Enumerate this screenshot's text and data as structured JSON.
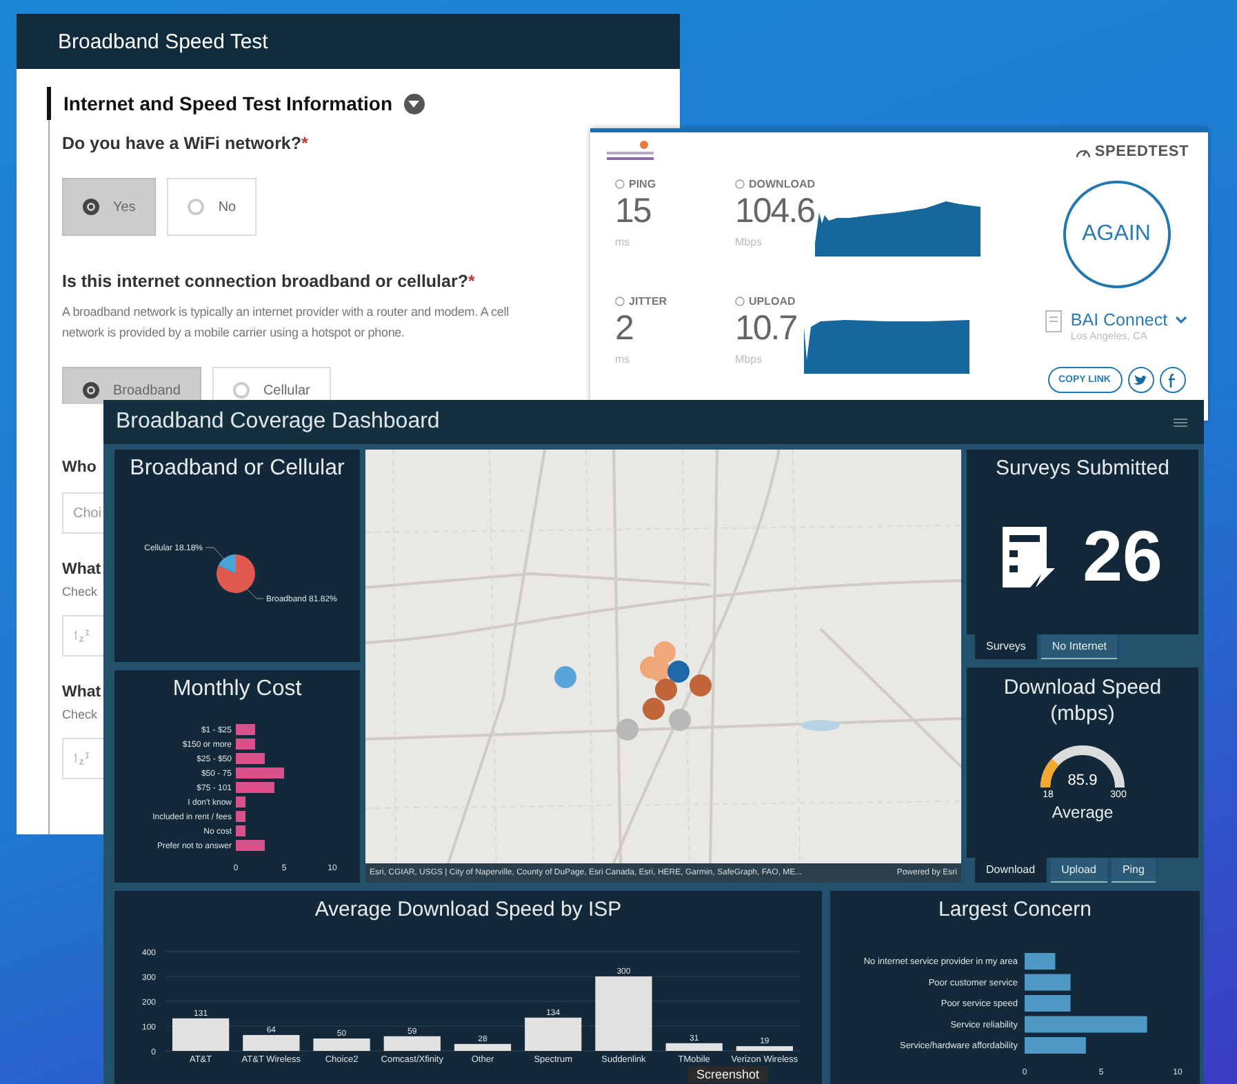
{
  "form": {
    "title": "Broadband Speed Test",
    "section_title": "Internet and Speed Test Information",
    "questions": [
      {
        "label": "Do you have a WiFi network?",
        "required_mark": "*",
        "options": [
          {
            "label": "Yes",
            "selected": true
          },
          {
            "label": "No",
            "selected": false
          }
        ]
      },
      {
        "label": "Is this internet connection broadband or cellular?",
        "required_mark": "*",
        "hint_lines": [
          "A broadband network is typically an internet provider with a router and modem. A cell",
          "network is provided by a mobile carrier using a hotspot or phone."
        ],
        "options": [
          {
            "label": "Broadband",
            "selected": true
          },
          {
            "label": "Cellular",
            "selected": false
          }
        ]
      }
    ],
    "covered_items": [
      {
        "kind": "question",
        "text": "Who"
      },
      {
        "kind": "field",
        "placeholder": "Choi"
      },
      {
        "kind": "question",
        "text": "What"
      },
      {
        "kind": "hint",
        "text": "Check"
      },
      {
        "kind": "number"
      },
      {
        "kind": "question",
        "text": "What"
      },
      {
        "kind": "hint",
        "text": "Check"
      },
      {
        "kind": "number"
      }
    ]
  },
  "speedtest": {
    "brand": "SPEEDTEST",
    "metrics": [
      {
        "label": "PING",
        "value": "15",
        "unit": "ms",
        "kind": "plain"
      },
      {
        "label": "DOWNLOAD",
        "value": "104.6",
        "unit": "Mbps",
        "kind": "graph"
      },
      {
        "label": "JITTER",
        "value": "2",
        "unit": "ms",
        "kind": "plain"
      },
      {
        "label": "UPLOAD",
        "value": "10.7",
        "unit": "Mbps",
        "kind": "graph"
      }
    ],
    "again_button": "AGAIN",
    "provider": "BAI Connect",
    "location": "Los Angeles, CA",
    "copy_link": "COPY LINK"
  },
  "dashboard": {
    "title": "Broadband Coverage Dashboard",
    "broadband_or_cellular": {
      "title": "Broadband or Cellular",
      "chart_data": {
        "type": "pie",
        "categories": [
          "Cellular",
          "Broadband"
        ],
        "values": [
          18.18,
          81.82
        ],
        "value_labels": [
          "18.18%",
          "81.82%"
        ]
      }
    },
    "monthly_cost": {
      "title": "Monthly Cost",
      "chart_data": {
        "type": "bar",
        "orientation": "horizontal",
        "categories": [
          "$1 - $25",
          "$150 or more",
          "$25 - $50",
          "$50 - 75",
          "$75 - 101",
          "I don't know",
          "Included in rent / fees",
          "No cost",
          "Prefer not to answer"
        ],
        "values": [
          2,
          2,
          3,
          5,
          4,
          1,
          1,
          1,
          3
        ],
        "xlim": [
          0,
          10
        ],
        "xticks": [
          0,
          5,
          10
        ]
      }
    },
    "map": {
      "attribution": "Esri, CGIAR, USGS | City of Naperville, County of DuPage, Esri Canada, Esri, HERE, Garmin, SafeGraph, FAO, ME...",
      "powered_by": "Powered by Esri"
    },
    "surveys": {
      "title": "Surveys Submitted",
      "count": "26",
      "tabs": [
        {
          "label": "Surveys",
          "selected": true
        },
        {
          "label": "No Internet",
          "selected": false
        }
      ]
    },
    "download_speed": {
      "title": "Download Speed (mbps)",
      "value": "85.9",
      "min": "18",
      "max": "300",
      "level": 0.24,
      "caption": "Average",
      "tabs": [
        {
          "label": "Download",
          "selected": true
        },
        {
          "label": "Upload",
          "selected": false
        },
        {
          "label": "Ping",
          "selected": false
        }
      ]
    },
    "isp_speed": {
      "title": "Average Download Speed by ISP",
      "chart_data": {
        "type": "bar",
        "orientation": "vertical",
        "categories": [
          "AT&T",
          "AT&T Wireless",
          "Choice2",
          "Comcast/Xfinity",
          "Other",
          "Spectrum",
          "Suddenlink",
          "TMobile",
          "Verizon Wireless"
        ],
        "values": [
          131,
          64,
          50,
          59,
          28,
          134,
          300,
          31,
          19
        ],
        "ylim": [
          0,
          400
        ],
        "yticks": [
          0,
          100,
          200,
          300,
          400
        ],
        "data_labels": true,
        "grid": true
      }
    },
    "largest_concern": {
      "title": "Largest Concern",
      "chart_data": {
        "type": "bar",
        "orientation": "horizontal",
        "categories": [
          "No internet service provider in my area",
          "Poor customer service",
          "Poor service speed",
          "Service reliability",
          "Service/hardware affordability"
        ],
        "values": [
          2,
          3,
          3,
          8,
          4
        ],
        "xlim": [
          0,
          10
        ],
        "xticks": [
          0,
          5,
          10
        ]
      }
    }
  },
  "tooltip": "Screenshot"
}
